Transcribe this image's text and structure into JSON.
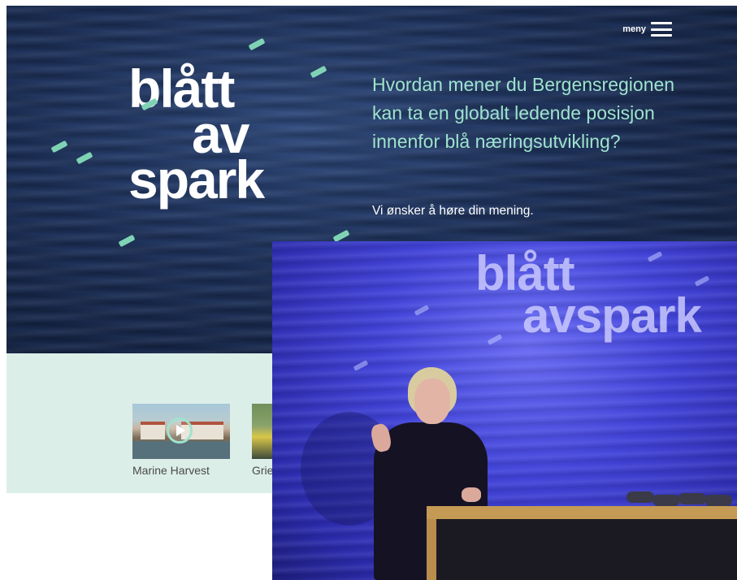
{
  "hero": {
    "menu_label": "meny",
    "logo": {
      "line1": "blått",
      "line2": "av",
      "line3": "spark"
    },
    "headline": "Hvordan mener du Bergensregionen kan ta en globalt ledende posisjon innenfor blå næringsutvikling?",
    "subline": "Vi ønsker å høre din mening."
  },
  "videos": [
    {
      "label": "Marine Harvest",
      "icon": "play-icon"
    },
    {
      "label": "Grie",
      "icon": "play-icon"
    }
  ],
  "photo": {
    "logo": {
      "line1": "blått",
      "line2": "avspark"
    }
  },
  "colors": {
    "hero_bg": "#1c3059",
    "headline": "#9ee3ce",
    "accent_dash": "#7fd3b4",
    "band_bg": "#dceee8",
    "stage_blue": "#4244d8"
  }
}
